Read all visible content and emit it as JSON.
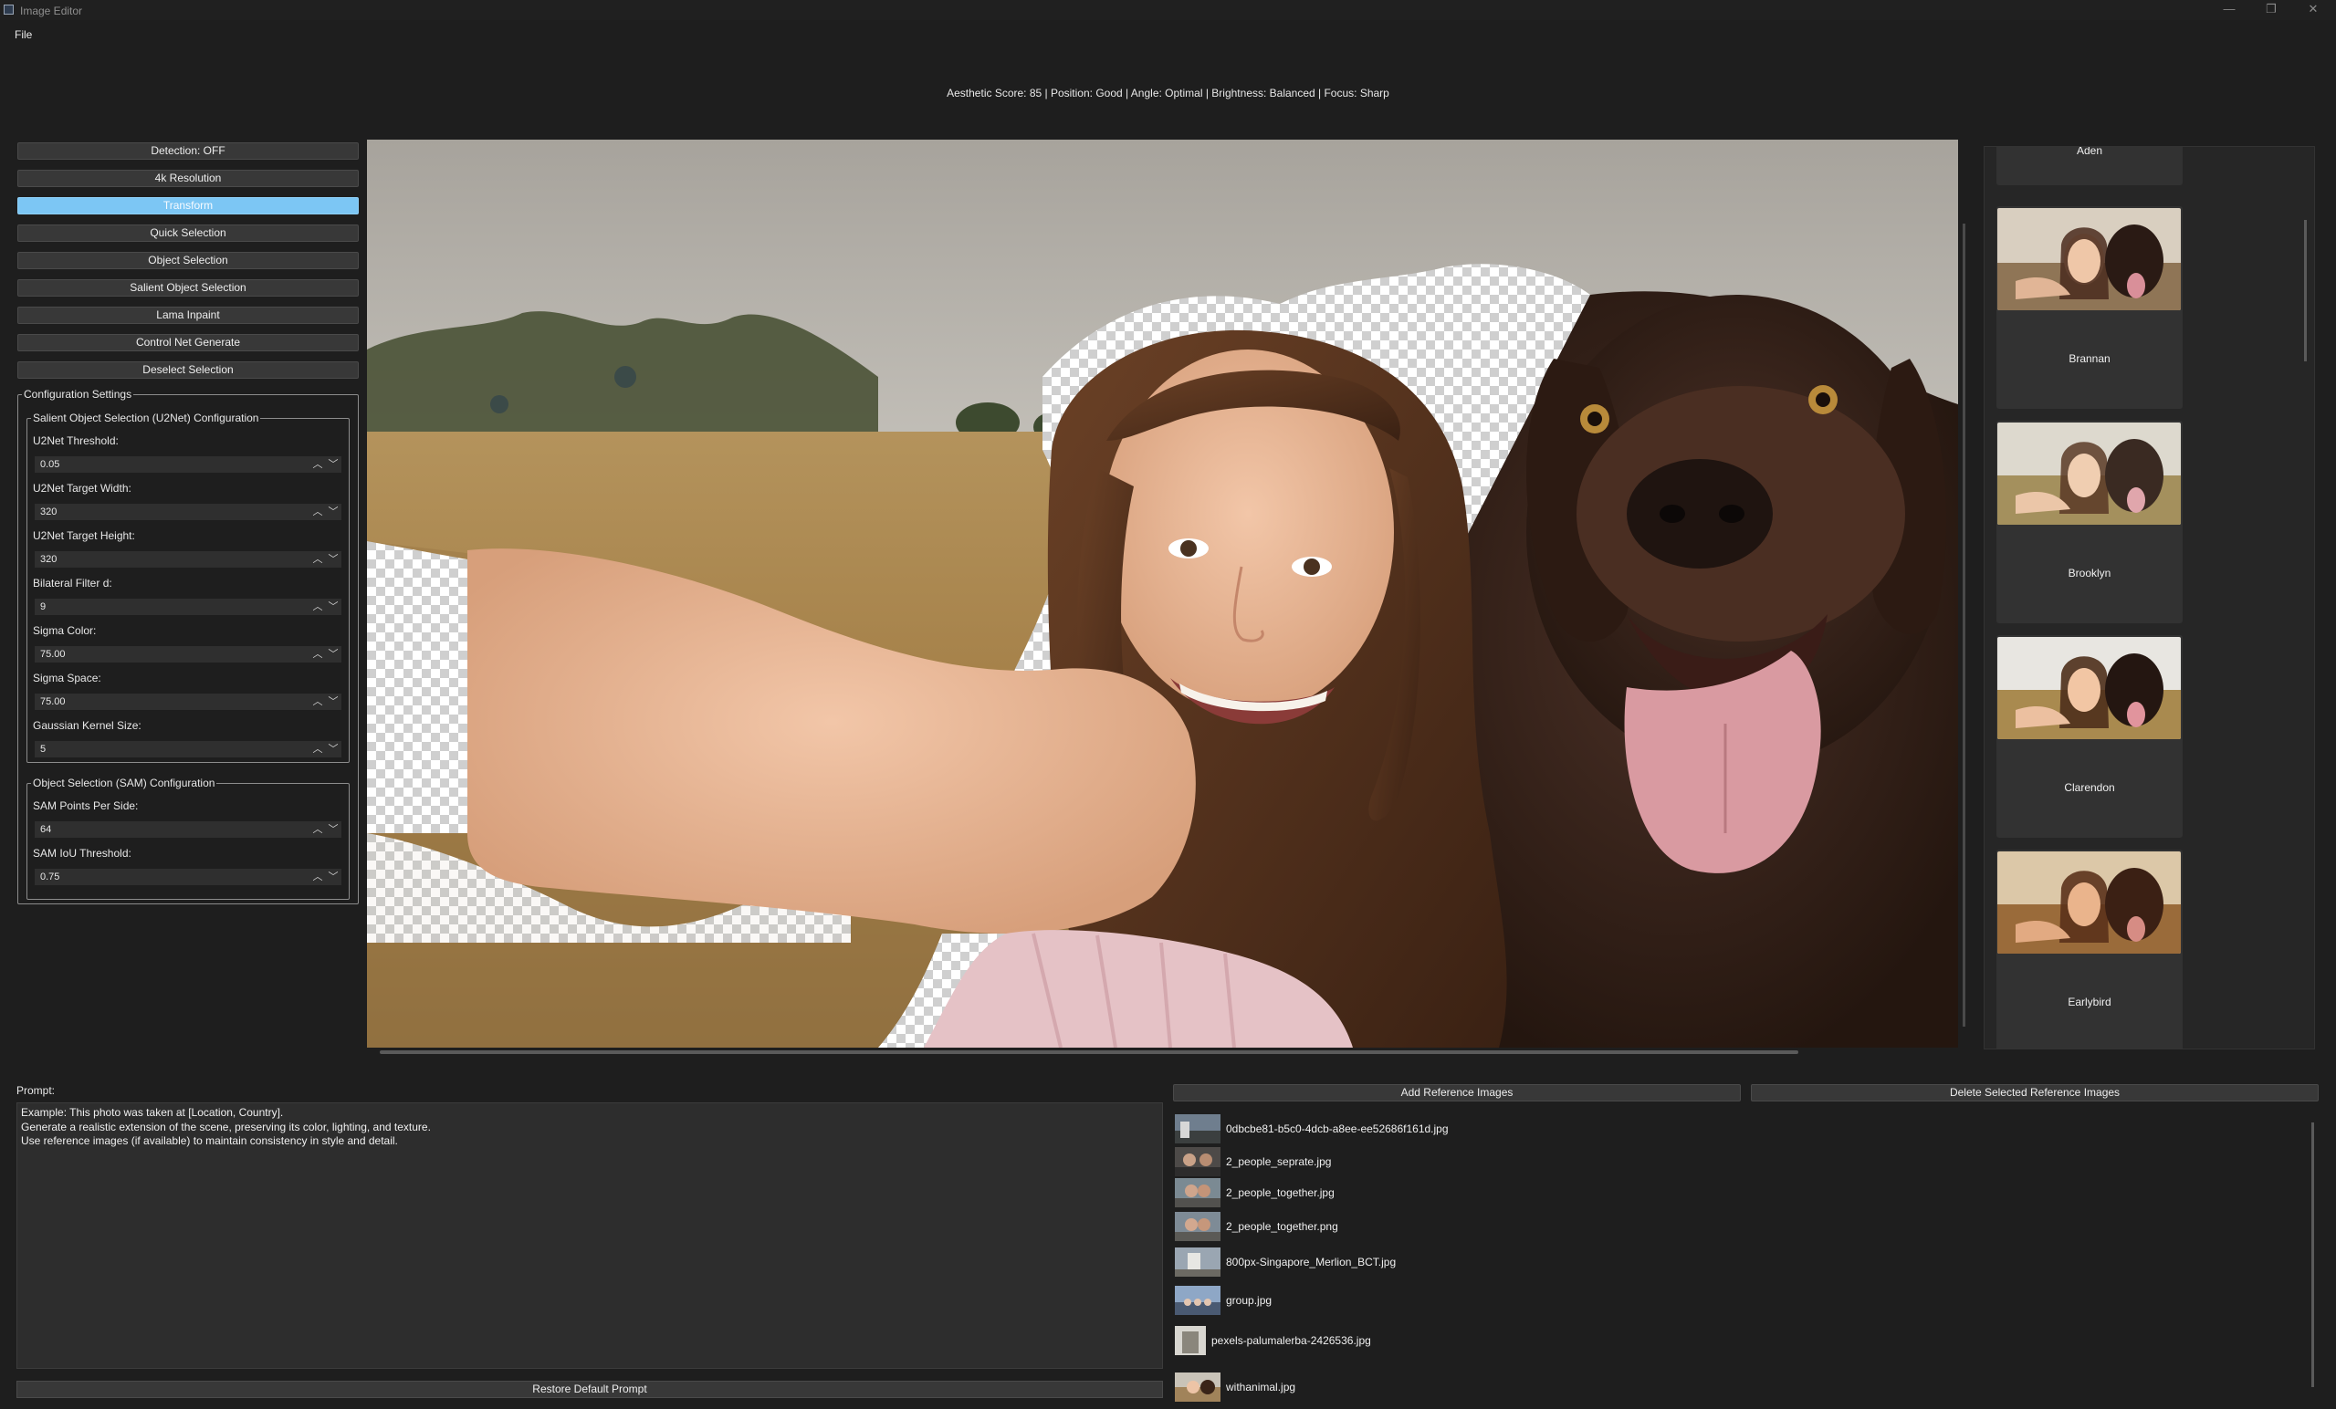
{
  "window": {
    "title": "Image Editor",
    "controls": {
      "minimize": "—",
      "maximize": "❐",
      "close": "✕"
    }
  },
  "menu": {
    "file": "File"
  },
  "info_bar": "Aesthetic Score: 85 | Position: Good | Angle: Optimal | Brightness: Balanced | Focus: Sharp",
  "toolbar": {
    "buttons": [
      {
        "label": "Detection: OFF"
      },
      {
        "label": "4k Resolution"
      },
      {
        "label": "Transform",
        "active": true
      },
      {
        "label": "Quick Selection"
      },
      {
        "label": "Object Selection"
      },
      {
        "label": "Salient Object Selection"
      },
      {
        "label": "Lama Inpaint"
      },
      {
        "label": "Control Net Generate"
      },
      {
        "label": "Deselect Selection"
      }
    ]
  },
  "config": {
    "title": "Configuration Settings",
    "u2net": {
      "title": "Salient Object Selection (U2Net) Configuration",
      "fields": [
        {
          "label": "U2Net Threshold:",
          "value": "0.05"
        },
        {
          "label": "U2Net Target Width:",
          "value": "320"
        },
        {
          "label": "U2Net Target Height:",
          "value": "320"
        },
        {
          "label": "Bilateral Filter d:",
          "value": "9"
        },
        {
          "label": "Sigma Color:",
          "value": "75.00"
        },
        {
          "label": "Sigma Space:",
          "value": "75.00"
        },
        {
          "label": "Gaussian Kernel Size:",
          "value": "5"
        }
      ]
    },
    "sam": {
      "title": "Object Selection (SAM) Configuration",
      "fields": [
        {
          "label": "SAM Points Per Side:",
          "value": "64"
        },
        {
          "label": "SAM IoU Threshold:",
          "value": "0.75"
        }
      ]
    }
  },
  "filters": {
    "partial_label": "Aden",
    "items": [
      {
        "label": "Brannan"
      },
      {
        "label": "Brooklyn"
      },
      {
        "label": "Clarendon"
      },
      {
        "label": "Earlybird"
      }
    ]
  },
  "prompt": {
    "label": "Prompt:",
    "text": "Example: This photo was taken at [Location, Country].\nGenerate a realistic extension of the scene, preserving its color, lighting, and texture.\nUse reference images (if available) to maintain consistency in style and detail.",
    "restore_label": "Restore Default Prompt"
  },
  "references": {
    "add_label": "Add Reference Images",
    "delete_label": "Delete Selected Reference Images",
    "items": [
      {
        "name": "0dbcbe81-b5c0-4dcb-a8ee-ee52686f161d.jpg"
      },
      {
        "name": "2_people_seprate.jpg"
      },
      {
        "name": "2_people_together.jpg"
      },
      {
        "name": "2_people_together.png"
      },
      {
        "name": "800px-Singapore_Merlion_BCT.jpg"
      },
      {
        "name": "group.jpg"
      },
      {
        "name": "pexels-palumalerba-2426536.jpg"
      },
      {
        "name": "withanimal.jpg"
      }
    ]
  }
}
